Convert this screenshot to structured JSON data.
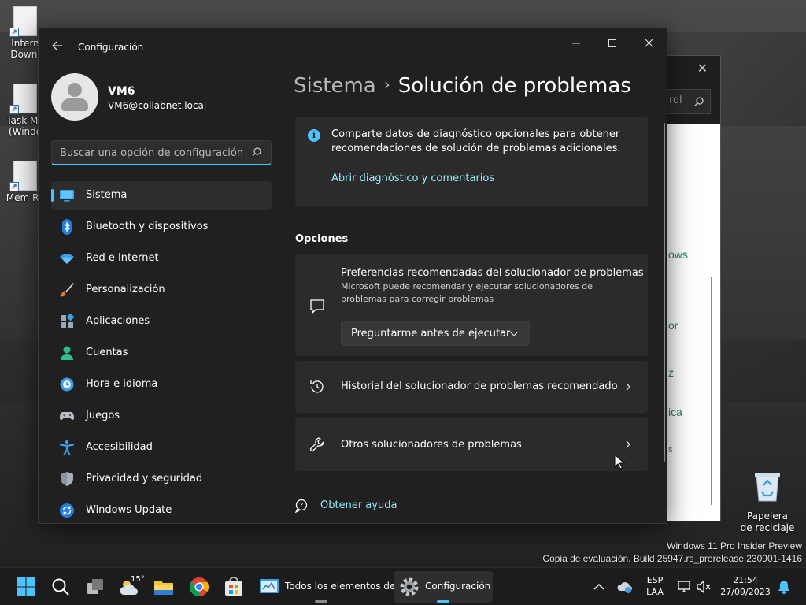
{
  "desktop": {
    "icons": [
      {
        "label": "Intern\nDownl"
      },
      {
        "label": "Task Ma\n(Windo"
      },
      {
        "label": "Mem Re"
      }
    ],
    "recycle_bin": "Papelera de reciclaje",
    "watermark_line1": "Windows 11 Pro Insider Preview",
    "watermark_line2": "Copia de evaluación. Build 25947.rs_prerelease.230901-1416"
  },
  "background_window": {
    "search_fragment": "rol",
    "fragments": [
      "ows",
      "or",
      "z",
      "ica",
      "s"
    ]
  },
  "settings": {
    "app_title": "Configuración",
    "user": {
      "name": "VM6",
      "email": "VM6@collabnet.local"
    },
    "search": {
      "placeholder": "Buscar una opción de configuración"
    },
    "nav": [
      {
        "label": "Sistema",
        "icon": "monitor-icon",
        "active": true
      },
      {
        "label": "Bluetooth y dispositivos",
        "icon": "bluetooth-icon"
      },
      {
        "label": "Red e Internet",
        "icon": "wifi-icon"
      },
      {
        "label": "Personalización",
        "icon": "brush-icon"
      },
      {
        "label": "Aplicaciones",
        "icon": "apps-icon"
      },
      {
        "label": "Cuentas",
        "icon": "person-icon"
      },
      {
        "label": "Hora e idioma",
        "icon": "globe-clock-icon"
      },
      {
        "label": "Juegos",
        "icon": "gamepad-icon"
      },
      {
        "label": "Accesibilidad",
        "icon": "accessibility-icon"
      },
      {
        "label": "Privacidad y seguridad",
        "icon": "shield-icon"
      },
      {
        "label": "Windows Update",
        "icon": "update-icon"
      }
    ],
    "breadcrumb": {
      "parent": "Sistema",
      "separator": "›",
      "current": "Solución de problemas"
    },
    "info": {
      "text": "Comparte datos de diagnóstico opcionales para obtener recomendaciones de solución de problemas adicionales.",
      "link": "Abrir diagnóstico y comentarios"
    },
    "options_label": "Opciones",
    "cards": {
      "preferences": {
        "title": "Preferencias recomendadas del solucionador de problemas",
        "desc": "Microsoft puede recomendar y ejecutar solucionadores de problemas para corregir problemas",
        "dropdown_value": "Preguntarme antes de ejecutar"
      },
      "history": {
        "title": "Historial del solucionador de problemas recomendado"
      },
      "others": {
        "title": "Otros solucionadores de problemas"
      }
    },
    "help": "Obtener ayuda",
    "accent": "#4cc2ff"
  },
  "taskbar": {
    "weather_temp": "15°",
    "apps": [
      {
        "label": "Todos los elementos de",
        "active": false
      },
      {
        "label": "Configuración",
        "active": true
      }
    ],
    "lang_line1": "ESP",
    "lang_line2": "LAA",
    "time": "21:54",
    "date": "27/09/2023"
  }
}
